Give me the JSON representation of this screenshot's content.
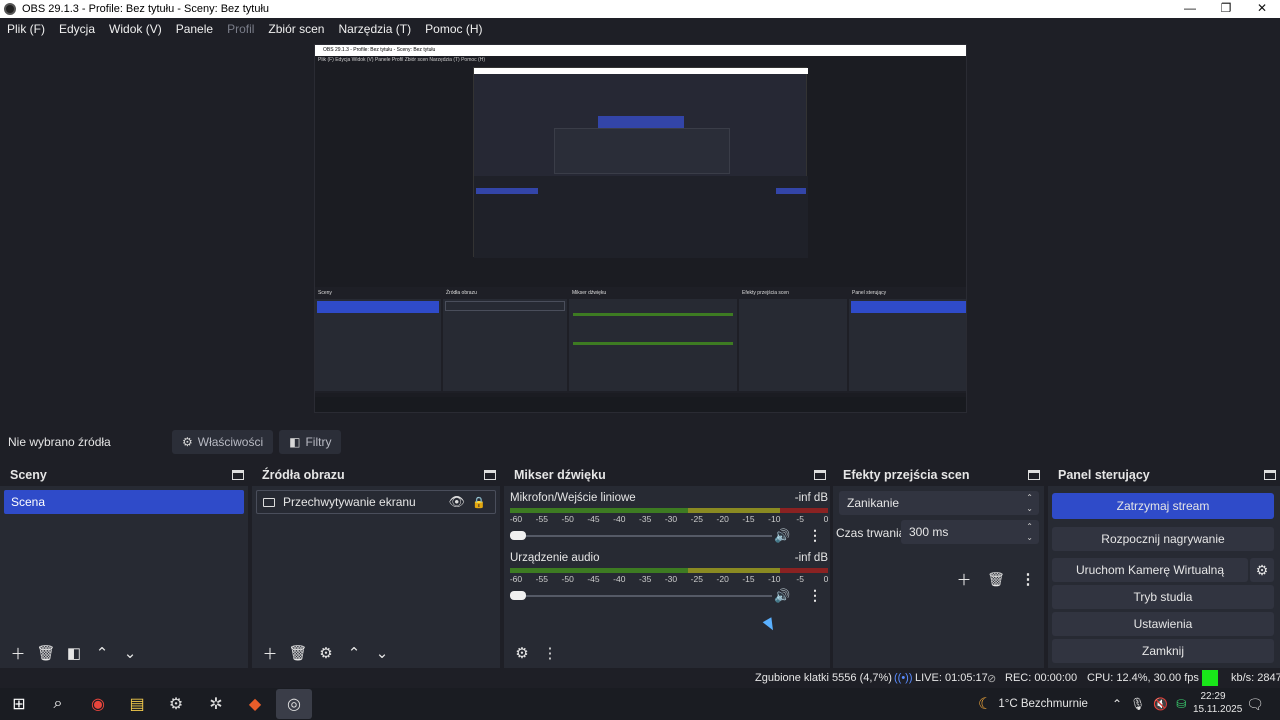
{
  "window": {
    "title": "OBS 29.1.3 - Profile: Bez tytułu - Sceny: Bez tytułu",
    "minimize": "—",
    "maximize": "❐",
    "close": "✕"
  },
  "menu": [
    {
      "label": "Plik (F)",
      "disabled": false
    },
    {
      "label": "Edycja",
      "disabled": false
    },
    {
      "label": "Widok (V)",
      "disabled": false
    },
    {
      "label": "Panele",
      "disabled": false
    },
    {
      "label": "Profil",
      "disabled": true
    },
    {
      "label": "Zbiór scen",
      "disabled": false
    },
    {
      "label": "Narzędzia (T)",
      "disabled": false
    },
    {
      "label": "Pomoc (H)",
      "disabled": false
    }
  ],
  "context_bar": {
    "no_source": "Nie wybrano źródła",
    "properties": "Właściwości",
    "filters": "Filtry"
  },
  "scenes": {
    "title": "Sceny",
    "items": [
      "Scena"
    ]
  },
  "sources": {
    "title": "Źródła obrazu",
    "items": [
      "Przechwytywanie ekranu"
    ]
  },
  "mixer": {
    "title": "Mikser dźwięku",
    "channels": [
      {
        "name": "Mikrofon/Wejście liniowe",
        "db": "-inf dB",
        "level": 0.0
      },
      {
        "name": "Urządzenie audio",
        "db": "-inf dB",
        "level": 0.0
      }
    ],
    "ticks": [
      "-60",
      "-55",
      "-50",
      "-45",
      "-40",
      "-35",
      "-30",
      "-25",
      "-20",
      "-15",
      "-10",
      "-5",
      "0"
    ]
  },
  "transitions": {
    "title": "Efekty przejścia scen",
    "selected": "Zanikanie",
    "duration_label": "Czas trwania",
    "duration_value": "300 ms"
  },
  "controls": {
    "title": "Panel sterujący",
    "stop_stream": "Zatrzymaj stream",
    "start_recording": "Rozpocznij nagrywanie",
    "virtual_cam": "Uruchom Kamerę Wirtualną",
    "studio_mode": "Tryb studia",
    "settings": "Ustawienia",
    "exit": "Zamknij"
  },
  "status": {
    "dropped": "Zgubione klatki 5556 (4,7%)",
    "live": "LIVE: 01:05:17",
    "rec": "REC: 00:00:00",
    "cpu": "CPU: 12.4%, 30.00 fps",
    "kbs": "kb/s: 2847",
    "indicator_color": "#19e619"
  },
  "taskbar": {
    "weather": "1°C Bezchmurnie",
    "time": "22:29",
    "date": "15.11.2025"
  },
  "preview": {
    "title": "OBS 29.1.3 - Profile: Bez tytułu - Sceny: Bez tytułu",
    "menu": "Plik (F)   Edycja   Widok (V)   Panele   Profil   Zbiór scen   Narzędzia (T)   Pomoc (H)",
    "dock_titles": [
      "Sceny",
      "Źródła obrazu",
      "Mikser dźwięku",
      "Efekty przejścia scen",
      "Panel sterujący"
    ]
  }
}
